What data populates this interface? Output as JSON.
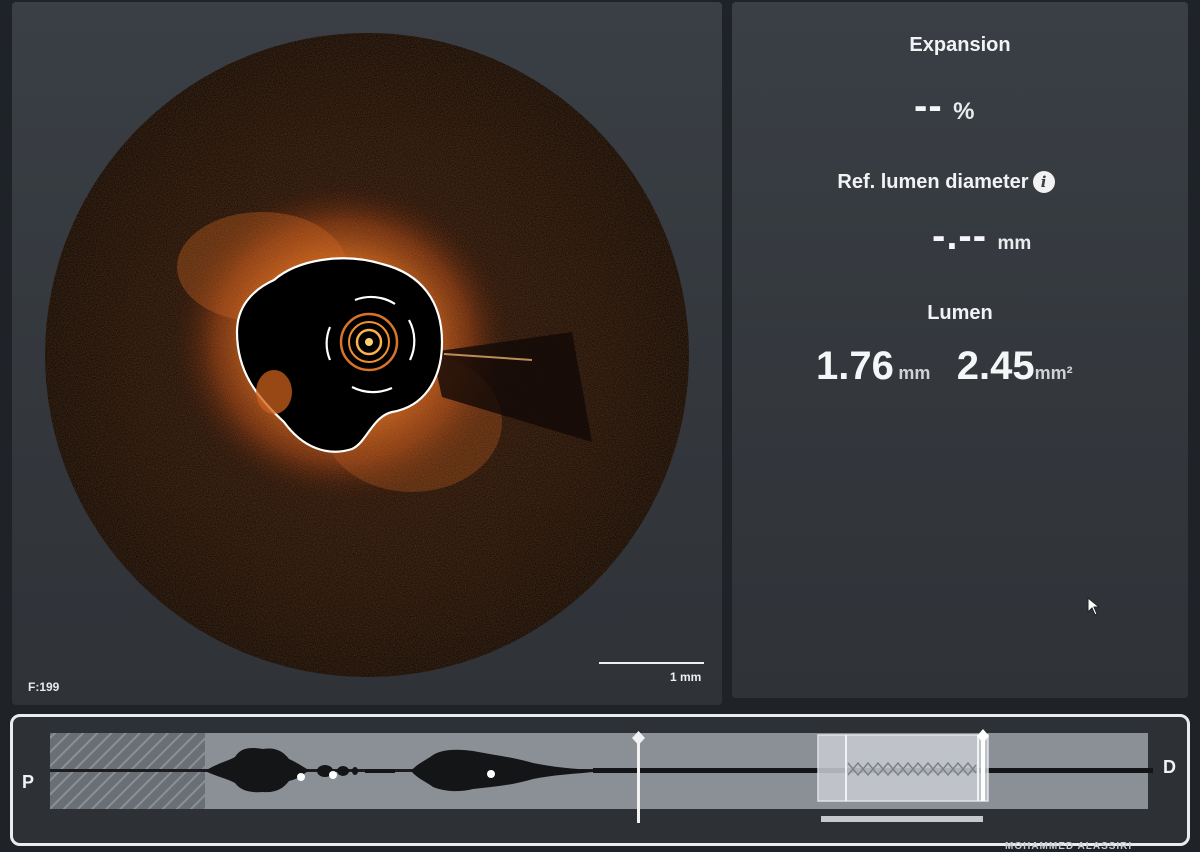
{
  "image_panel": {
    "frame_label": "F:199",
    "scale_label": "1 mm"
  },
  "metrics": {
    "expansion": {
      "title": "Expansion",
      "value": "--",
      "unit": "%"
    },
    "ref_lumen": {
      "title": "Ref. lumen diameter",
      "value": "-.--",
      "unit": "mm",
      "info_icon": "info-icon"
    },
    "lumen": {
      "title": "Lumen",
      "diameter_value": "1.76",
      "diameter_unit": "mm",
      "area_value": "2.45",
      "area_unit": "mm²"
    }
  },
  "longitudinal": {
    "proximal_label": "P",
    "distal_label": "D"
  },
  "footer": {
    "operator_name": "MOHAMMED ALASSIRI"
  },
  "colors": {
    "background": "#1f2226",
    "panel": "#373b40",
    "oct_tissue": "#d9661c",
    "lumen_contour": "#ffffff",
    "highlight_frame": "#e9edf1"
  }
}
